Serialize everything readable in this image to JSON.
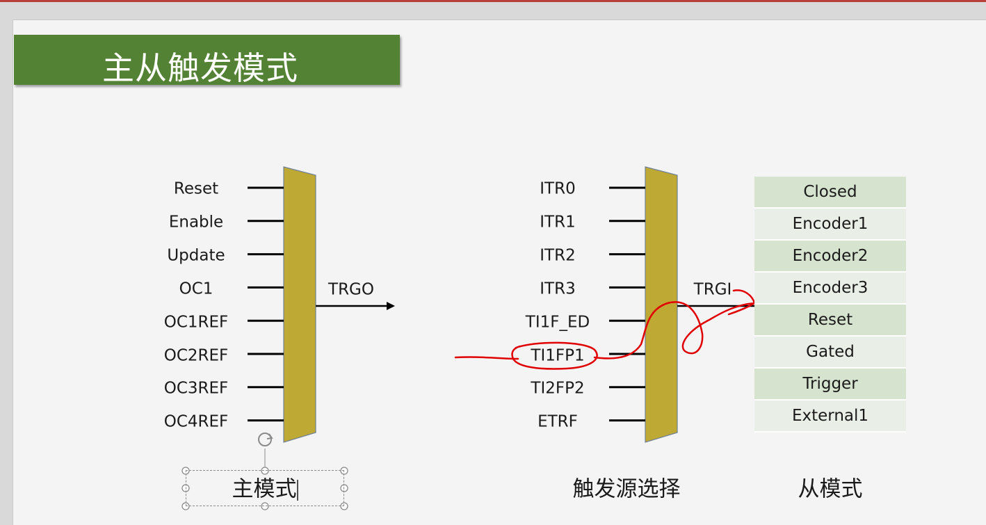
{
  "title": "主从触发模式",
  "master": {
    "inputs": [
      "Reset",
      "Enable",
      "Update",
      "OC1",
      "OC1REF",
      "OC2REF",
      "OC3REF",
      "OC4REF"
    ],
    "output_label": "TRGO",
    "caption": "主模式"
  },
  "trigger_select": {
    "inputs": [
      "ITR0",
      "ITR1",
      "ITR2",
      "ITR3",
      "TI1F_ED",
      "TI1FP1",
      "TI2FP2",
      "ETRF"
    ],
    "output_label": "TRGI",
    "caption": "触发源选择"
  },
  "slave": {
    "modes": [
      "Closed",
      "Encoder1",
      "Encoder2",
      "Encoder3",
      "Reset",
      "Gated",
      "Trigger",
      "External1"
    ],
    "caption": "从模式"
  },
  "colors": {
    "title_bg": "#548235",
    "mux_fill": "#bfa935",
    "row_dark": "#d6e3cf",
    "row_light": "#e9efe6",
    "annotation": "#e00000"
  }
}
